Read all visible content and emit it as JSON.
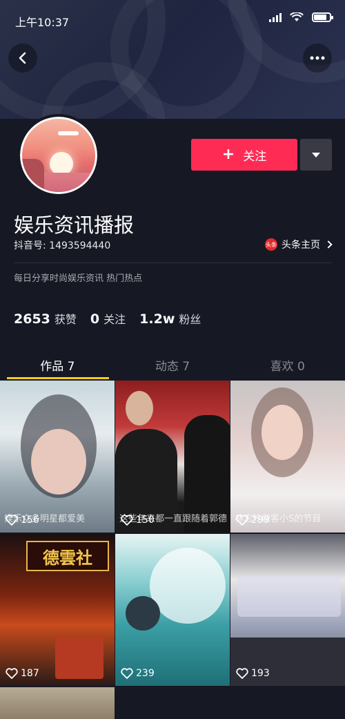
{
  "status_bar": {
    "time": "上午10:37"
  },
  "profile": {
    "nickname": "娱乐资讯播报",
    "douyin_id": "抖音号: 1493594440",
    "toutiao_label": "头条主页",
    "toutiao_logo_text": "头条",
    "bio": "每日分享时尚娱乐资讯 热门热点",
    "follow_label": "关注",
    "follow_plus": "+"
  },
  "stats": [
    {
      "num": "2653",
      "label": "获赞"
    },
    {
      "num": "0",
      "label": "关注"
    },
    {
      "num": "1.2w",
      "label": "粉丝"
    }
  ],
  "tabs": [
    {
      "label": "作品 7"
    },
    {
      "label": "动态 7"
    },
    {
      "label": "喜欢 0"
    }
  ],
  "videos": [
    {
      "likes": "156",
      "caption": "娱乐众多明星都爱美"
    },
    {
      "likes": "150",
      "caption": "这些年来都一直跟随着郭德"
    },
    {
      "likes": "299",
      "caption": "林志玲做客小S的节目"
    },
    {
      "likes": "187",
      "caption": "",
      "sign_text": "德雲社"
    },
    {
      "likes": "239",
      "caption": ""
    },
    {
      "likes": "193",
      "caption": ""
    },
    {
      "likes": "",
      "caption": ""
    }
  ],
  "colors": {
    "background": "#161823",
    "accent": "#fe2c55",
    "tab_underline": "#face15"
  },
  "icons": {
    "back": "chevron-left-icon",
    "more": "more-dots-icon",
    "dropdown": "triangle-down-icon",
    "heart": "heart-outline-icon"
  }
}
